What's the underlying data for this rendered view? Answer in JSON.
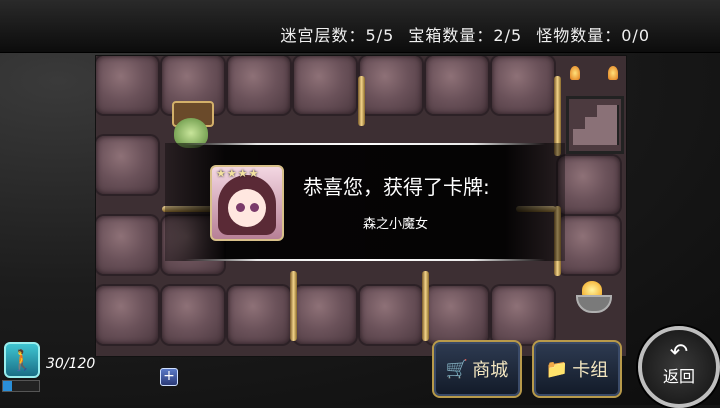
{
  "status": {
    "maze_floor_label": "迷宫层数：",
    "maze_floor_value": "5/5",
    "chest_label": "宝箱数量：",
    "chest_value": "2/5",
    "monster_label": "怪物数量：",
    "monster_value": "0/0"
  },
  "dialog": {
    "title": "恭喜您，获得了卡牌:",
    "card_name": "森之小魔女",
    "card_stars": "★★★★",
    "card_rarity": 4
  },
  "energy": {
    "text": "30/120",
    "current": 30,
    "max": 120,
    "plus_label": "+"
  },
  "buttons": {
    "shop_label": "商城",
    "deck_label": "卡组",
    "back_label": "返回",
    "back_arrow": "↶"
  },
  "icons": {
    "energy": "walking-person-icon",
    "shop": "cart-icon",
    "deck": "folder-icon",
    "back": "return-arrow-icon"
  },
  "colors": {
    "button_border": "#b89a4a",
    "energy_fill": "#2a8fd8",
    "accent_text": "#f3e6c0"
  }
}
